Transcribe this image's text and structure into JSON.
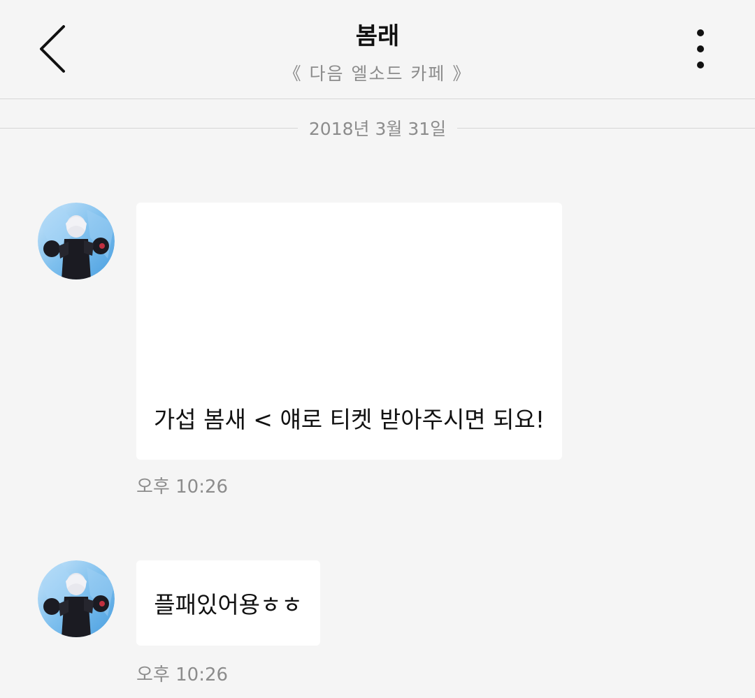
{
  "header": {
    "title": "봄래",
    "subtitle": "《 다음 엘소드 카페 》",
    "back_icon": "chevron-left-icon",
    "more_icon": "more-vertical-icon"
  },
  "date_divider": "2018년 3월 31일",
  "messages": [
    {
      "text": "가섭 봄새 < 얘로 티켓 받아주시면 되요!",
      "time": "오후 10:26"
    },
    {
      "text": "플패있어용ㅎㅎ",
      "time": "오후 10:26"
    }
  ],
  "colors": {
    "background": "#f5f5f5",
    "bubble": "#ffffff",
    "muted_text": "#8c8c8c",
    "divider": "#d6d6d6"
  }
}
